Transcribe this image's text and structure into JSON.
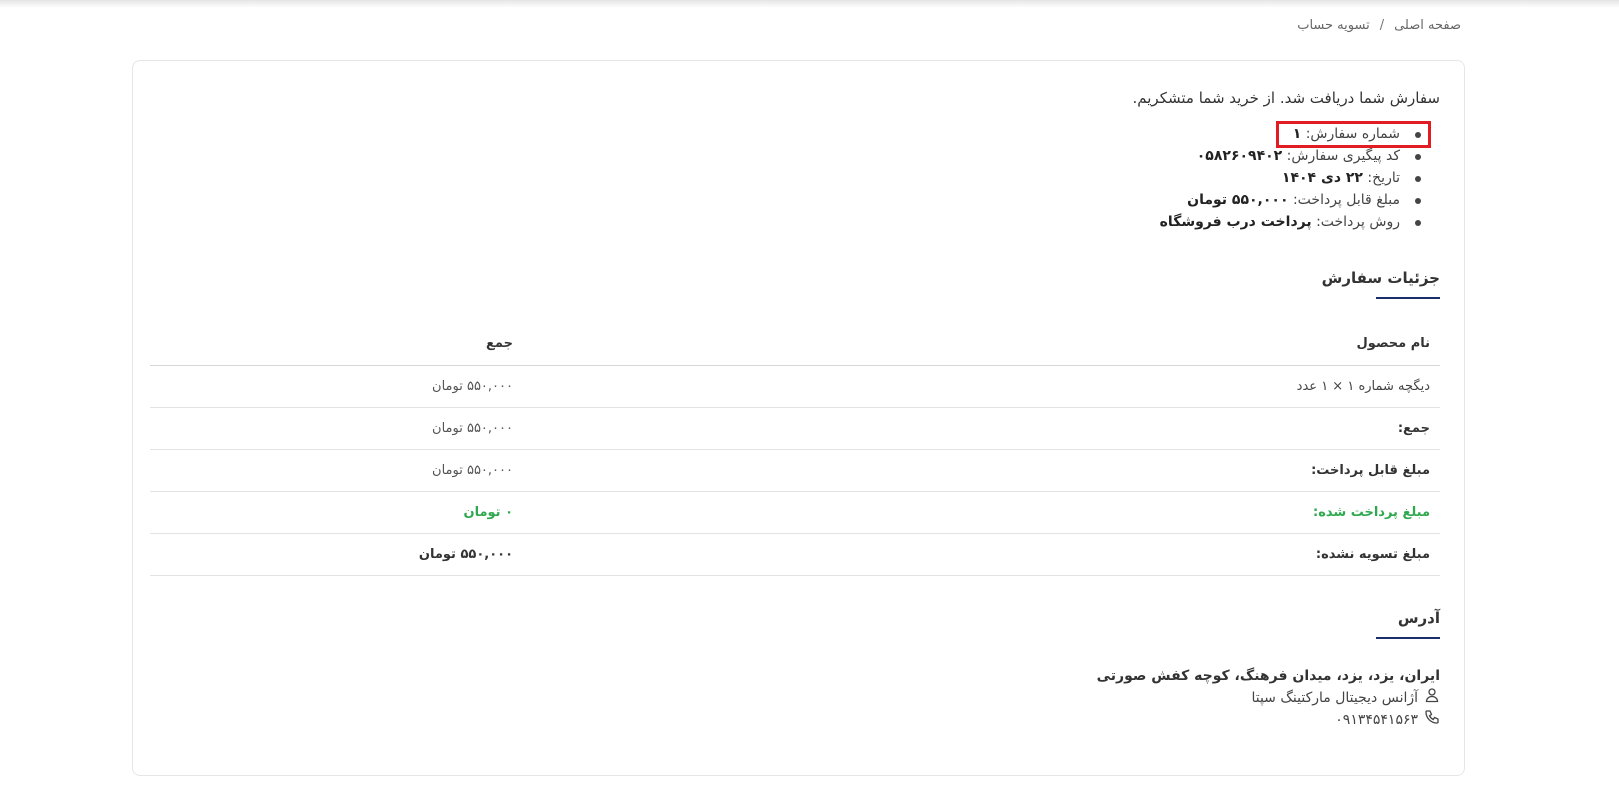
{
  "breadcrumb": {
    "home": "صفحه اصلی",
    "separator": "/",
    "current": "تسویه حساب"
  },
  "order": {
    "thank_you": "سفارش شما دریافت شد. از خرید شما متشکریم.",
    "overview": {
      "number_label": "شماره سفارش:",
      "number_value": "۱",
      "tracking_label": "کد پیگیری سفارش:",
      "tracking_value": "۰۵۸۲۶۰۹۴۰۲",
      "date_label": "تاریخ:",
      "date_value": "۲۲ دی ۱۴۰۴",
      "amount_label": "مبلغ قابل پرداخت:",
      "amount_value": "۵۵۰,۰۰۰ تومان",
      "method_label": "روش پرداخت:",
      "method_value": "پرداخت درب فروشگاه"
    }
  },
  "details": {
    "title": "جزئیات سفارش",
    "headers": {
      "product": "نام محصول",
      "total": "جمع"
    },
    "item": {
      "name": "دیگچه شماره ۱ × ۱ عدد",
      "total": "۵۵۰,۰۰۰ تومان"
    },
    "rows": [
      {
        "label": "جمع:",
        "value": "۵۵۰,۰۰۰ تومان"
      },
      {
        "label": "مبلغ قابل پرداخت:",
        "value": "۵۵۰,۰۰۰ تومان"
      },
      {
        "label": "مبلغ پرداخت شده:",
        "value": "۰ تومان"
      },
      {
        "label": "مبلغ تسویه نشده:",
        "value": "۵۵۰,۰۰۰ تومان"
      }
    ]
  },
  "address": {
    "title": "آدرس",
    "line": "ایران، یزد، یزد، میدان فرهنگ، کوچه کفش صورتی",
    "name": "آژانس دیجیتال مارکتینگ سپتا",
    "phone": "۰۹۱۳۴۵۴۱۵۶۳",
    "icons": {
      "person": "user-icon",
      "phone": "phone-icon"
    }
  },
  "colors": {
    "accent": "#1a2f6e",
    "paid_green": "#2fa84f",
    "highlight_red": "#e31b23"
  }
}
